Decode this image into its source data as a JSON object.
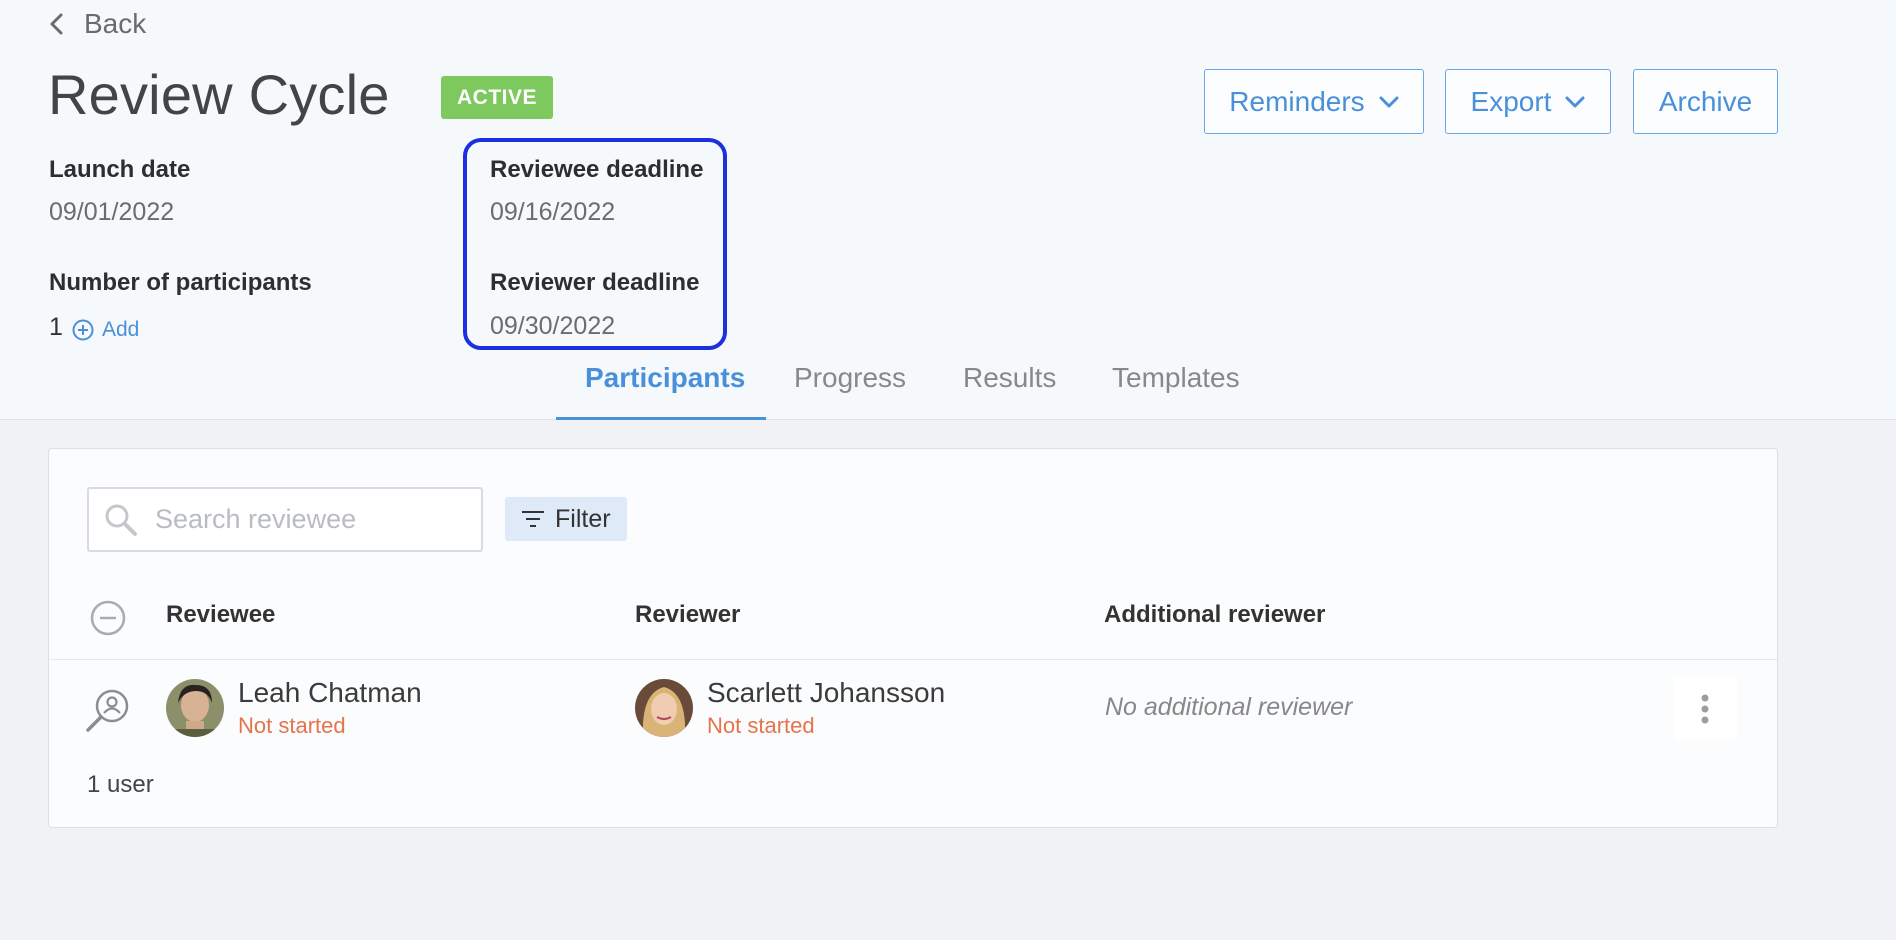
{
  "nav": {
    "back_label": "Back"
  },
  "header": {
    "title": "Review Cycle",
    "status": "ACTIVE",
    "actions": {
      "reminders": "Reminders",
      "export": "Export",
      "archive": "Archive"
    }
  },
  "meta": {
    "launch_date_label": "Launch date",
    "launch_date": "09/01/2022",
    "participants_label": "Number of participants",
    "participants_count": "1",
    "add_label": "Add",
    "reviewee_deadline_label": "Reviewee deadline",
    "reviewee_deadline": "09/16/2022",
    "reviewer_deadline_label": "Reviewer deadline",
    "reviewer_deadline": "09/30/2022"
  },
  "tabs": [
    {
      "label": "Participants",
      "active": true
    },
    {
      "label": "Progress",
      "active": false
    },
    {
      "label": "Results",
      "active": false
    },
    {
      "label": "Templates",
      "active": false
    }
  ],
  "participants": {
    "search_placeholder": "Search reviewee",
    "filter_label": "Filter",
    "columns": {
      "reviewee": "Reviewee",
      "reviewer": "Reviewer",
      "additional": "Additional reviewer"
    },
    "rows": [
      {
        "reviewee": {
          "name": "Leah Chatman",
          "status": "Not started"
        },
        "reviewer": {
          "name": "Scarlett Johansson",
          "status": "Not started"
        },
        "additional": "No additional reviewer"
      }
    ],
    "footer": "1 user"
  },
  "colors": {
    "accent": "#4a90d9",
    "status_active": "#7dc95e",
    "status_not_started": "#e6734b",
    "highlight": "#1c30e0"
  }
}
